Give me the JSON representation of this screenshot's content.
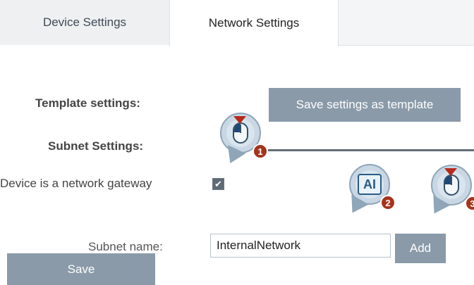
{
  "tabs": [
    {
      "label": "Device Settings",
      "active": false
    },
    {
      "label": "Network Settings",
      "active": true
    }
  ],
  "template_settings": {
    "label": "Template settings:",
    "button_label": "Save settings as template"
  },
  "subnet_settings": {
    "label": "Subnet Settings:"
  },
  "gateway": {
    "label": "Device is a network gateway",
    "checked": true,
    "check_glyph": "✔"
  },
  "subnet_name": {
    "label": "Subnet name:",
    "value": "InternalNetwork",
    "add_button_label": "Add"
  },
  "save_button_label": "Save",
  "callouts": [
    {
      "icon": "mouse-click-icon",
      "step": "1"
    },
    {
      "icon": "text-input-icon",
      "step": "2",
      "glyph": "AI"
    },
    {
      "icon": "mouse-click-icon",
      "step": "3"
    }
  ],
  "colors": {
    "button_bg": "#8a9aa9",
    "badge_bg": "#a5341c",
    "callout_bg": "#c8d7e3"
  }
}
